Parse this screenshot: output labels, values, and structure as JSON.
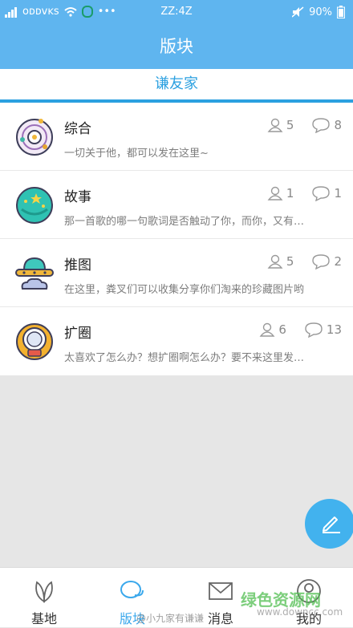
{
  "status": {
    "carrier": "ᴏᴅᴅᴠᴋs",
    "dots": "•••",
    "time": "ZZ:4Z",
    "battery": "90%"
  },
  "header": {
    "title": "版块"
  },
  "group": {
    "name": "谦友家"
  },
  "boards": [
    {
      "name": "综合",
      "desc": "一切关于他，都可以发在这里~",
      "members": "5",
      "posts": "8"
    },
    {
      "name": "故事",
      "desc": "那一首歌的哪一句歌词是否触动了你，而你，又有…",
      "members": "1",
      "posts": "1"
    },
    {
      "name": "推图",
      "desc": "在这里，粪叉们可以收集分享你们淘来的珍藏图片哟",
      "members": "5",
      "posts": "2"
    },
    {
      "name": "扩圈",
      "desc": "太喜欢了怎么办？想扩圈啊怎么办？要不来这里发…",
      "members": "6",
      "posts": "13"
    }
  ],
  "tabs": [
    {
      "label": "基地",
      "icon": "leaf-icon"
    },
    {
      "label": "版块",
      "icon": "chat-bubbles-icon"
    },
    {
      "label": "消息",
      "icon": "envelope-icon"
    },
    {
      "label": "我的",
      "icon": "profile-icon"
    }
  ],
  "watermark": {
    "brand": "绿色资源网",
    "url": "www.downcc.com",
    "weibo": "@小九家有谦谦"
  },
  "colors": {
    "primary": "#5fb5ef",
    "accent": "#2ba0e0",
    "fab": "#42b2ee"
  }
}
